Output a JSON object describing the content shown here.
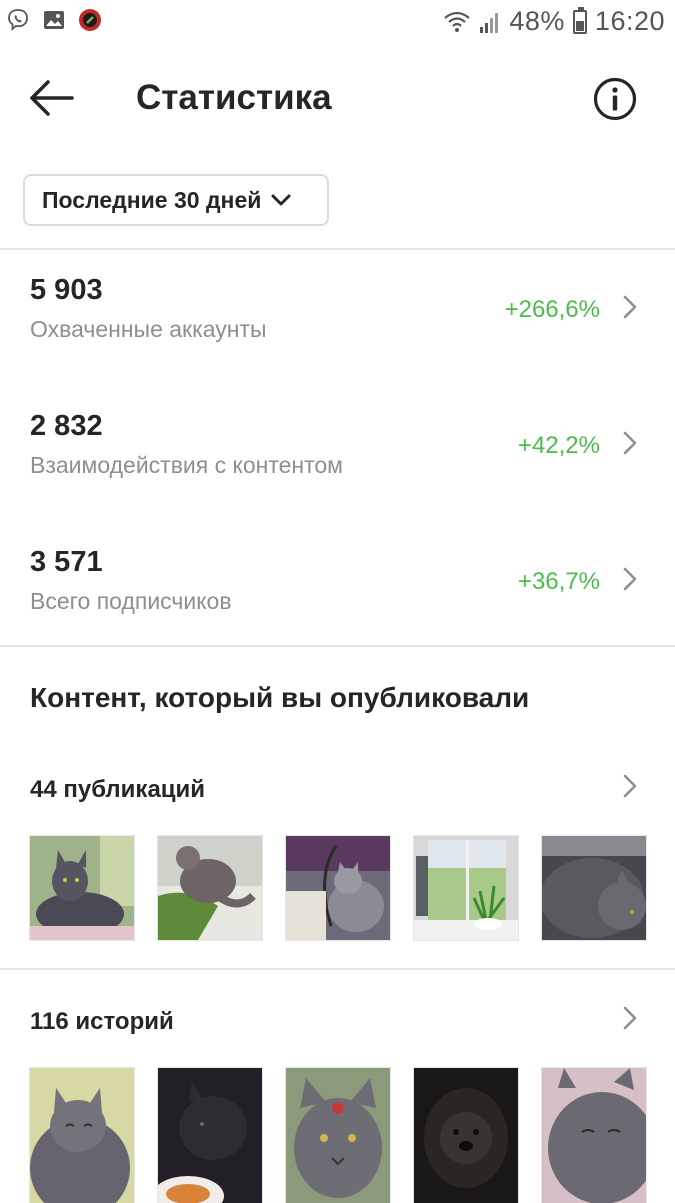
{
  "status_bar": {
    "battery_percent": "48%",
    "time": "16:20",
    "icons": [
      "viber-icon",
      "gallery-icon",
      "app-icon",
      "wifi-icon",
      "signal-icon",
      "battery-icon"
    ]
  },
  "header": {
    "title": "Статистика",
    "back_icon": "back-arrow-icon",
    "info_icon": "info-icon"
  },
  "period": {
    "selected": "Последние 30 дней"
  },
  "metrics": [
    {
      "value": "5 903",
      "label": "Охваченные аккаунты",
      "change": "+266,6%"
    },
    {
      "value": "2 832",
      "label": "Взаимодействия с контентом",
      "change": "+42,2%"
    },
    {
      "value": "3 571",
      "label": "Всего подписчиков",
      "change": "+36,7%"
    }
  ],
  "content": {
    "title": "Контент, который вы опубликовали",
    "posts": {
      "label": "44 публикаций"
    },
    "stories": {
      "label": "116 историй"
    }
  },
  "colors": {
    "positive": "#4cbd4c",
    "text_primary": "#262626",
    "text_secondary": "#8e8e8e",
    "divider": "#e4e4e4"
  }
}
